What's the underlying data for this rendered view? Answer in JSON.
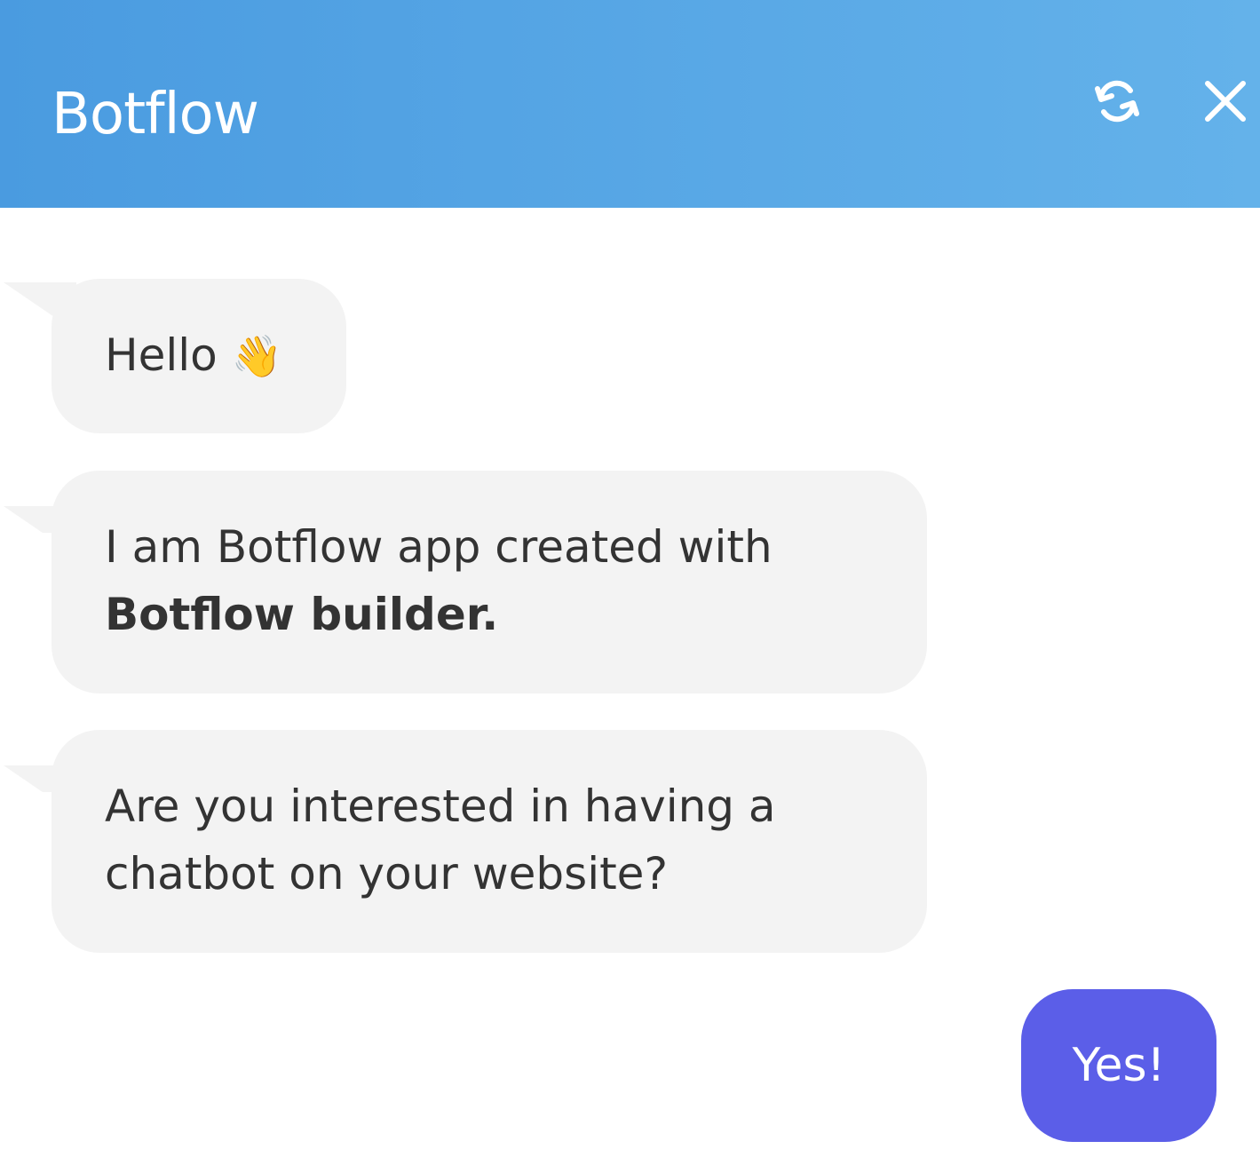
{
  "header": {
    "title": "Botflow",
    "restart_icon": "restart-icon",
    "close_icon": "close-icon"
  },
  "messages": [
    {
      "text": "Hello",
      "emoji": "👋"
    },
    {
      "text": "I am Botflow app created with",
      "bold": "Botflow builder."
    },
    {
      "line1": "Are you interested in having a",
      "line2": "chatbot on your website?"
    }
  ],
  "reply": {
    "label": "Yes!"
  },
  "colors": {
    "header_start": "#4a9be0",
    "header_end": "#64b2ea",
    "bubble_bg": "#f3f3f3",
    "reply_bg": "#5b5ee8",
    "text": "#333333"
  }
}
